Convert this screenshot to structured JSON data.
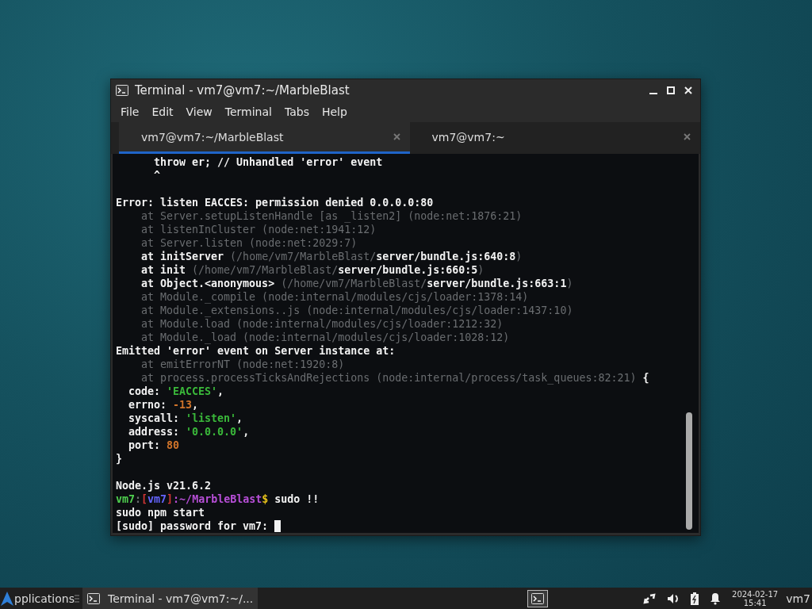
{
  "window": {
    "title": "Terminal - vm7@vm7:~/MarbleBlast"
  },
  "menu": [
    "File",
    "Edit",
    "View",
    "Terminal",
    "Tabs",
    "Help"
  ],
  "tabs": [
    {
      "label": "vm7@vm7:~/MarbleBlast",
      "selected": true
    },
    {
      "label": "vm7@vm7:~",
      "selected": false
    }
  ],
  "terminal": {
    "lines": [
      {
        "kind": "text",
        "segments": [
          {
            "text": "      throw er; // Unhandled 'error' event",
            "color": "#f2f2f2",
            "bold": true
          }
        ]
      },
      {
        "kind": "text",
        "segments": [
          {
            "text": "      ^",
            "color": "#f2f2f2",
            "bold": true
          }
        ]
      },
      {
        "kind": "blank"
      },
      {
        "kind": "text",
        "segments": [
          {
            "text": "Error: listen EACCES: permission denied 0.0.0.0:80",
            "color": "#f2f2f2",
            "bold": true
          }
        ]
      },
      {
        "kind": "text",
        "segments": [
          {
            "text": "    at Server.setupListenHandle [as _listen2] (node:net:1876:21)",
            "color": "#6a6d70",
            "bold": false
          }
        ]
      },
      {
        "kind": "text",
        "segments": [
          {
            "text": "    at listenInCluster (node:net:1941:12)",
            "color": "#6a6d70",
            "bold": false
          }
        ]
      },
      {
        "kind": "text",
        "segments": [
          {
            "text": "    at Server.listen (node:net:2029:7)",
            "color": "#6a6d70",
            "bold": false
          }
        ]
      },
      {
        "kind": "text",
        "segments": [
          {
            "text": "    at initServer ",
            "color": "#f2f2f2",
            "bold": true
          },
          {
            "text": "(/home/vm7/MarbleBlast/",
            "color": "#6a6d70",
            "bold": false
          },
          {
            "text": "server/bundle.js:640:8",
            "color": "#f2f2f2",
            "bold": true
          },
          {
            "text": ")",
            "color": "#6a6d70",
            "bold": false
          }
        ]
      },
      {
        "kind": "text",
        "segments": [
          {
            "text": "    at init ",
            "color": "#f2f2f2",
            "bold": true
          },
          {
            "text": "(/home/vm7/MarbleBlast/",
            "color": "#6a6d70",
            "bold": false
          },
          {
            "text": "server/bundle.js:660:5",
            "color": "#f2f2f2",
            "bold": true
          },
          {
            "text": ")",
            "color": "#6a6d70",
            "bold": false
          }
        ]
      },
      {
        "kind": "text",
        "segments": [
          {
            "text": "    at Object.<anonymous> ",
            "color": "#f2f2f2",
            "bold": true
          },
          {
            "text": "(/home/vm7/MarbleBlast/",
            "color": "#6a6d70",
            "bold": false
          },
          {
            "text": "server/bundle.js:663:1",
            "color": "#f2f2f2",
            "bold": true
          },
          {
            "text": ")",
            "color": "#6a6d70",
            "bold": false
          }
        ]
      },
      {
        "kind": "text",
        "segments": [
          {
            "text": "    at Module._compile (node:internal/modules/cjs/loader:1378:14)",
            "color": "#6a6d70",
            "bold": false
          }
        ]
      },
      {
        "kind": "text",
        "segments": [
          {
            "text": "    at Module._extensions..js (node:internal/modules/cjs/loader:1437:10)",
            "color": "#6a6d70",
            "bold": false
          }
        ]
      },
      {
        "kind": "text",
        "segments": [
          {
            "text": "    at Module.load (node:internal/modules/cjs/loader:1212:32)",
            "color": "#6a6d70",
            "bold": false
          }
        ]
      },
      {
        "kind": "text",
        "segments": [
          {
            "text": "    at Module._load (node:internal/modules/cjs/loader:1028:12)",
            "color": "#6a6d70",
            "bold": false
          }
        ]
      },
      {
        "kind": "text",
        "segments": [
          {
            "text": "Emitted 'error' event on Server instance at:",
            "color": "#f2f2f2",
            "bold": true
          }
        ]
      },
      {
        "kind": "text",
        "segments": [
          {
            "text": "    at emitErrorNT (node:net:1920:8)",
            "color": "#6a6d70",
            "bold": false
          }
        ]
      },
      {
        "kind": "text",
        "segments": [
          {
            "text": "    at process.processTicksAndRejections (node:internal/process/task_queues:82:21)",
            "color": "#6a6d70",
            "bold": false
          },
          {
            "text": " {",
            "color": "#f2f2f2",
            "bold": true
          }
        ]
      },
      {
        "kind": "text",
        "segments": [
          {
            "text": "  code: ",
            "color": "#f2f2f2",
            "bold": true
          },
          {
            "text": "'EACCES'",
            "color": "#3ab83a",
            "bold": true
          },
          {
            "text": ",",
            "color": "#f2f2f2",
            "bold": true
          }
        ]
      },
      {
        "kind": "text",
        "segments": [
          {
            "text": "  errno: ",
            "color": "#f2f2f2",
            "bold": true
          },
          {
            "text": "-13",
            "color": "#d0742a",
            "bold": true
          },
          {
            "text": ",",
            "color": "#f2f2f2",
            "bold": true
          }
        ]
      },
      {
        "kind": "text",
        "segments": [
          {
            "text": "  syscall: ",
            "color": "#f2f2f2",
            "bold": true
          },
          {
            "text": "'listen'",
            "color": "#3ab83a",
            "bold": true
          },
          {
            "text": ",",
            "color": "#f2f2f2",
            "bold": true
          }
        ]
      },
      {
        "kind": "text",
        "segments": [
          {
            "text": "  address: ",
            "color": "#f2f2f2",
            "bold": true
          },
          {
            "text": "'0.0.0.0'",
            "color": "#3ab83a",
            "bold": true
          },
          {
            "text": ",",
            "color": "#f2f2f2",
            "bold": true
          }
        ]
      },
      {
        "kind": "text",
        "segments": [
          {
            "text": "  port: ",
            "color": "#f2f2f2",
            "bold": true
          },
          {
            "text": "80",
            "color": "#d0742a",
            "bold": true
          }
        ]
      },
      {
        "kind": "text",
        "segments": [
          {
            "text": "}",
            "color": "#f2f2f2",
            "bold": true
          }
        ]
      },
      {
        "kind": "blank"
      },
      {
        "kind": "text",
        "segments": [
          {
            "text": "Node.js v21.6.2",
            "color": "#f2f2f2",
            "bold": true
          }
        ]
      },
      {
        "kind": "text",
        "segments": [
          {
            "text": "vm7",
            "color": "#4fd04f",
            "bold": true
          },
          {
            "text": ":",
            "color": "#6a6d70",
            "bold": true
          },
          {
            "text": "[",
            "color": "#d03535",
            "bold": true
          },
          {
            "text": "vm7",
            "color": "#6464ff",
            "bold": true
          },
          {
            "text": "]",
            "color": "#d03535",
            "bold": true
          },
          {
            "text": ":~/MarbleBlast",
            "color": "#b84fd8",
            "bold": true
          },
          {
            "text": "$",
            "color": "#e8c21a",
            "bold": true
          },
          {
            "text": " sudo !!",
            "color": "#f2f2f2",
            "bold": true
          }
        ]
      },
      {
        "kind": "text",
        "segments": [
          {
            "text": "sudo npm start",
            "color": "#f2f2f2",
            "bold": true
          }
        ]
      },
      {
        "kind": "cursor",
        "segments": [
          {
            "text": "[sudo] password for vm7: ",
            "color": "#f2f2f2",
            "bold": true
          }
        ]
      }
    ]
  },
  "taskbar": {
    "menu_label": "pplications",
    "task": "Terminal - vm7@vm7:~/...",
    "date": "2024-02-17",
    "time": "15:41",
    "user": "vm7"
  }
}
